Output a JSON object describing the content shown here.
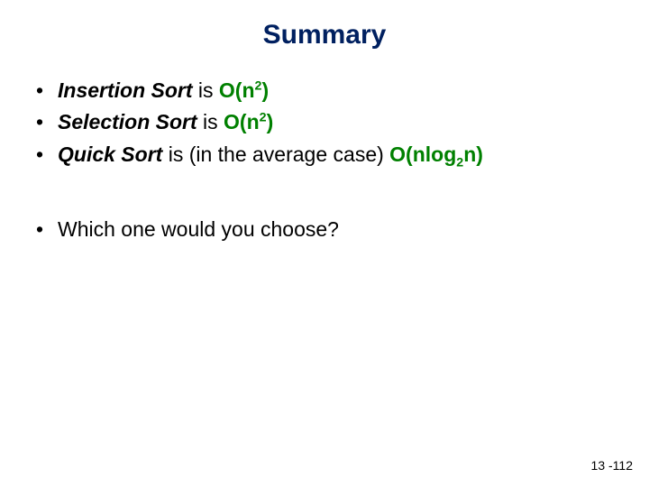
{
  "title": "Summary",
  "items": {
    "i1": {
      "name": "Insertion Sort",
      "verb": " is ",
      "o_open": "O(n",
      "o_exp": "2",
      "o_close": ")"
    },
    "i2": {
      "name": "Selection Sort",
      "verb": " is ",
      "o_open": "O(n",
      "o_exp": "2",
      "o_close": ")"
    },
    "i3": {
      "name": "Quick Sort",
      "verb": " is (in the average case) ",
      "o_a": "O(nlog",
      "o_sub": "2",
      "o_b": "n)"
    },
    "i4": {
      "text": "Which one would you choose?"
    }
  },
  "footer": "13 -112"
}
